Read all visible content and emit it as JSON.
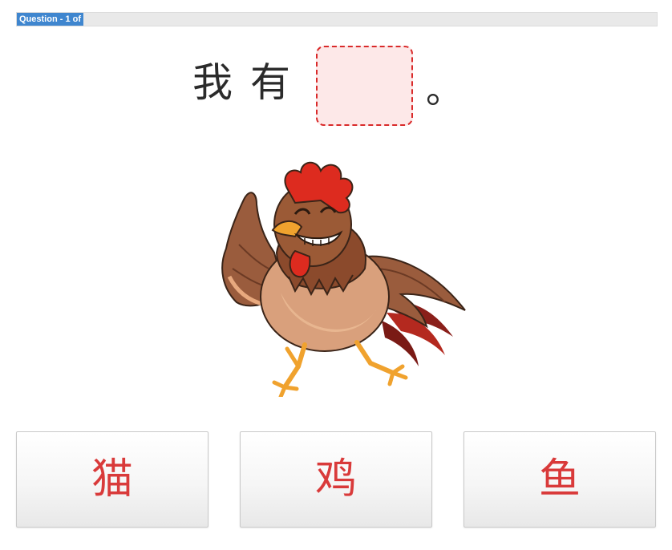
{
  "progress": {
    "label": "Question - 1 of"
  },
  "question": {
    "words": [
      "我",
      "有"
    ],
    "period": "。"
  },
  "options": [
    {
      "text": "猫"
    },
    {
      "text": "鸡"
    },
    {
      "text": "鱼"
    }
  ],
  "colors": {
    "progress_label_bg": "#3f86cf",
    "blank_border": "#d92a2a",
    "blank_fill": "#fde8e8",
    "option_text": "#d93a3a"
  }
}
